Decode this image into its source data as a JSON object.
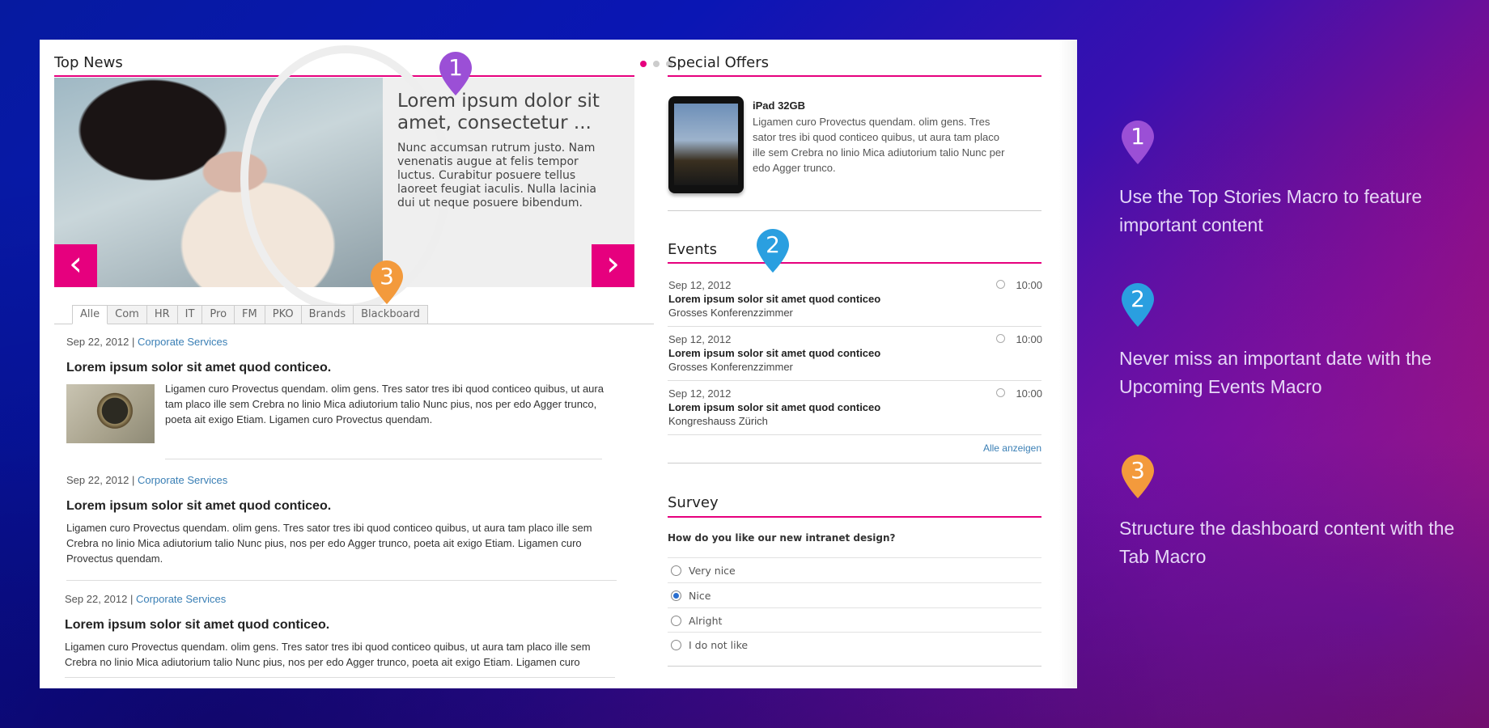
{
  "top_news": {
    "heading": "Top News",
    "slide_title": "Lorem ipsum dolor sit amet, consectetur ...",
    "slide_body": "Nunc accumsan rutrum justo. Nam venenatis augue at felis tempor luctus. Curabitur posuere tellus laoreet feugiat iaculis. Nulla lacinia dui ut neque posuere bibendum.",
    "prev_arrow": "‹",
    "next_arrow": "›",
    "tabs": [
      "Alle",
      "Com",
      "HR",
      "IT",
      "Pro",
      "FM",
      "PKO",
      "Brands",
      "Blackboard"
    ],
    "articles": [
      {
        "date": "Sep 22, 2012 | ",
        "category": "Corporate Services",
        "title": "Lorem ipsum solor sit amet quod conticeo.",
        "body": "Ligamen curo Provectus quendam. olim gens. Tres sator tres ibi quod conticeo quibus, ut aura tam placo ille sem Crebra no linio Mica adiutorium talio Nunc pius, nos per edo Agger trunco, poeta ait exigo Etiam. Ligamen curo Provectus quendam."
      },
      {
        "date": "Sep 22, 2012 | ",
        "category": "Corporate Services",
        "title": "Lorem ipsum solor sit amet quod conticeo.",
        "body": "Ligamen curo Provectus quendam. olim gens. Tres sator tres ibi quod conticeo quibus, ut aura tam placo ille sem Crebra no linio Mica adiutorium talio Nunc pius, nos per edo Agger trunco, poeta ait exigo Etiam. Ligamen curo Provectus quendam."
      },
      {
        "date": "Sep 22, 2012 | ",
        "category": "Corporate Services",
        "title": "Lorem ipsum solor sit amet quod conticeo.",
        "body": "Ligamen curo Provectus quendam. olim gens. Tres sator tres ibi quod conticeo quibus, ut aura tam placo ille sem Crebra no linio Mica adiutorium talio Nunc pius, nos per edo Agger trunco, poeta ait exigo Etiam. Ligamen curo"
      }
    ]
  },
  "special_offers": {
    "heading": "Special Offers",
    "title": "iPad 32GB",
    "text": "Ligamen curo Provectus quendam. olim gens. Tres sator tres ibi quod conticeo quibus, ut aura tam placo ille sem Crebra no linio Mica adiutorium talio Nunc per edo Agger trunco."
  },
  "events": {
    "heading": "Events",
    "items": [
      {
        "date": "Sep 12, 2012",
        "time": "10:00",
        "title": "Lorem ipsum solor sit amet quod conticeo",
        "location": "Grosses Konferenzzimmer"
      },
      {
        "date": "Sep 12, 2012",
        "time": "10:00",
        "title": "Lorem ipsum solor sit amet quod conticeo",
        "location": "Grosses Konferenzzimmer"
      },
      {
        "date": "Sep 12, 2012",
        "time": "10:00",
        "title": "Lorem ipsum solor sit amet quod conticeo",
        "location": "Kongreshauss Zürich"
      }
    ],
    "show_all": "Alle anzeigen"
  },
  "survey": {
    "heading": "Survey",
    "question": "How do you like our new intranet design?",
    "options": [
      "Very nice",
      "Nice",
      "Alright",
      "I do not like"
    ],
    "selected": "Nice"
  },
  "callouts": [
    {
      "number": "1",
      "text": "Use the Top Stories Macro to feature important content",
      "color": "#9b4fd6"
    },
    {
      "number": "2",
      "text": "Never miss an important date with the Upcoming Events Macro",
      "color": "#2a9fe0"
    },
    {
      "number": "3",
      "text": "Structure the dashboard content with the Tab Macro",
      "color": "#f39a3c"
    }
  ],
  "colors": {
    "accent": "#e6007e",
    "link": "#3a7fb5"
  }
}
